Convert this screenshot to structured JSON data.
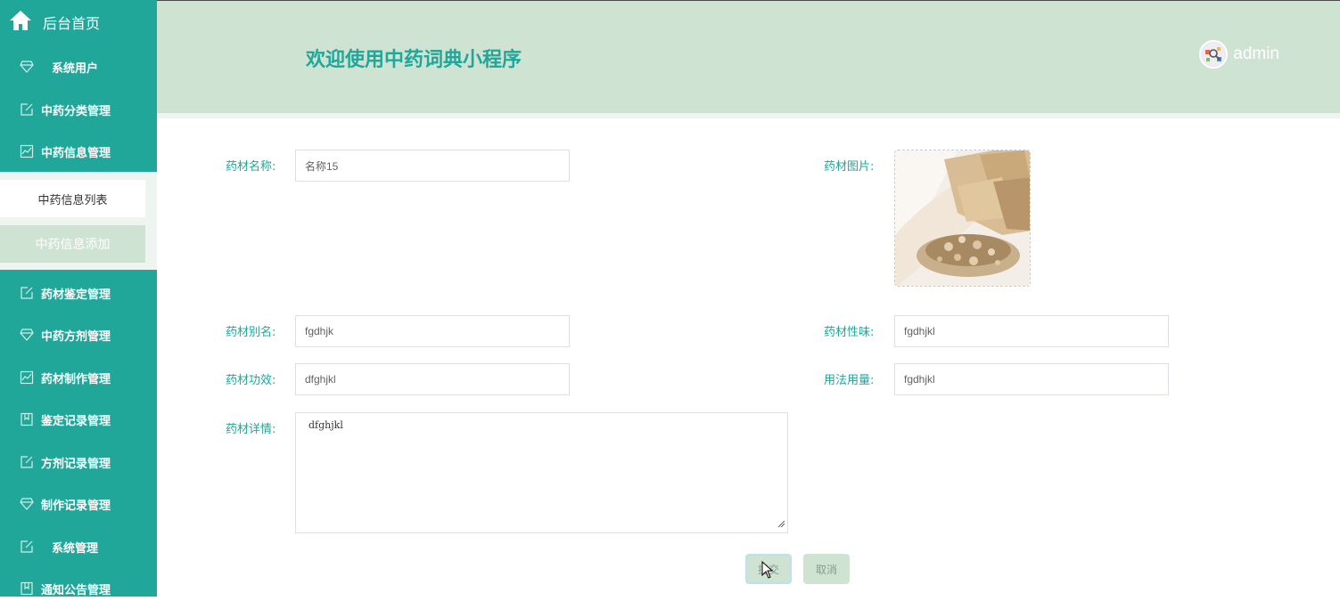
{
  "sidebar": {
    "home_label": "后台首页",
    "items": [
      {
        "label": "系统用户",
        "icon": "diamond-icon"
      },
      {
        "label": "中药分类管理",
        "icon": "edit-icon"
      },
      {
        "label": "中药信息管理",
        "icon": "chart-icon"
      },
      {
        "label": "药材鉴定管理",
        "icon": "edit-icon"
      },
      {
        "label": "中药方剂管理",
        "icon": "diamond-icon"
      },
      {
        "label": "药材制作管理",
        "icon": "chart-icon"
      },
      {
        "label": "鉴定记录管理",
        "icon": "bookmark-icon"
      },
      {
        "label": "方剂记录管理",
        "icon": "edit-icon"
      },
      {
        "label": "制作记录管理",
        "icon": "diamond-icon"
      },
      {
        "label": "系统管理",
        "icon": "edit-icon"
      },
      {
        "label": "通知公告管理",
        "icon": "bookmark-icon"
      }
    ],
    "submenu": {
      "list_label": "中药信息列表",
      "add_label": "中药信息添加"
    }
  },
  "header": {
    "title": "欢迎使用中药词典小程序",
    "username": "admin"
  },
  "form": {
    "name": {
      "label": "药材名称:",
      "value": "名称15"
    },
    "image": {
      "label": "药材图片:"
    },
    "alias": {
      "label": "药材别名:",
      "value": "fgdhjk"
    },
    "nature": {
      "label": "药材性味:",
      "value": "fgdhjkl"
    },
    "efficacy": {
      "label": "药材功效:",
      "value": "dfghjkl"
    },
    "usage": {
      "label": "用法用量:",
      "value": "fgdhjkl"
    },
    "detail": {
      "label": "药材详情:",
      "value": "dfghjkl"
    }
  },
  "buttons": {
    "submit": "提交",
    "cancel": "取消"
  },
  "colors": {
    "sidebar": "#21a69a",
    "header": "#cfe3d2",
    "accent": "#21a69a"
  }
}
